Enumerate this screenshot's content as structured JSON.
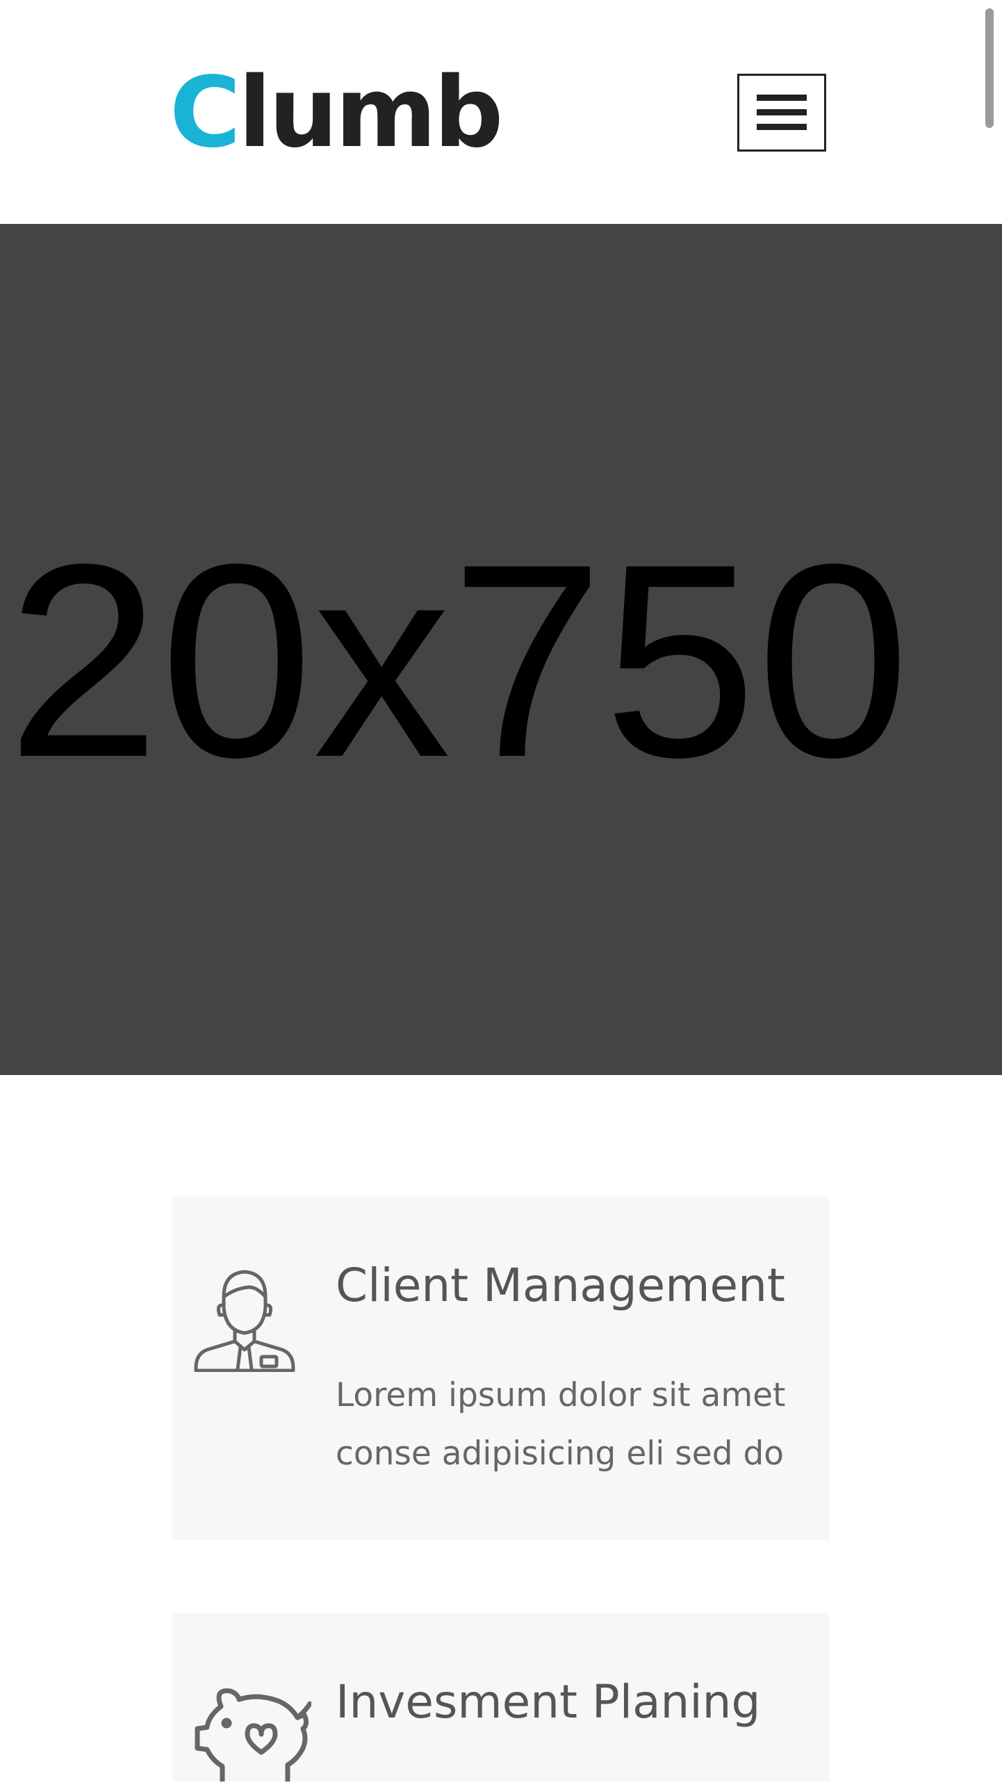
{
  "header": {
    "logo_first_letter": "C",
    "logo_rest": "lumb",
    "menu_button_label": "Menu"
  },
  "hero": {
    "placeholder_text": "20x750"
  },
  "services": [
    {
      "title": "Client Management",
      "text": "Lorem ipsum dolor sit amet conse adipisicing eli sed do",
      "icon": "businessman-icon"
    },
    {
      "title": "Invesment Planing",
      "icon": "piggy-bank-icon"
    }
  ],
  "colors": {
    "brand_accent": "#19b3d6",
    "hero_background": "#444444",
    "card_background": "#f7f7f7",
    "text_dark": "#222222",
    "text_muted": "#666666"
  }
}
